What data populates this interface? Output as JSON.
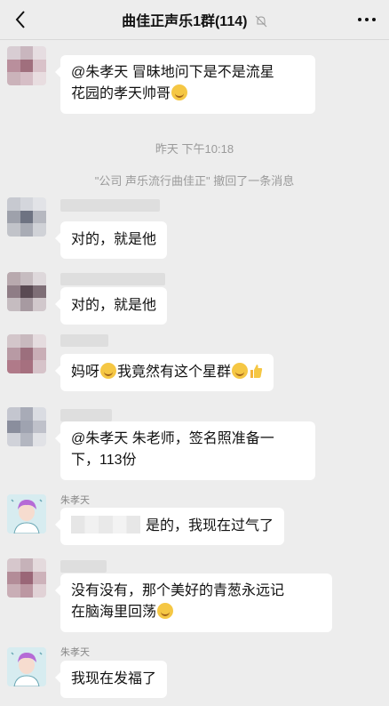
{
  "header": {
    "back_icon": "chevron-left-icon",
    "title": "曲佳正声乐1群(114)",
    "mute_icon": "bell-off-icon",
    "more_icon": "more-dots-icon"
  },
  "system": {
    "time": "昨天 下午10:18",
    "recall": "\"公司 声乐流行曲佳正\" 撤回了一条消息"
  },
  "messages": [
    {
      "text1": "@朱孝天 冒昧地问下是不是流星",
      "text2": "花园的孝天帅哥"
    },
    {
      "text": "对的，就是他"
    },
    {
      "text": "对的，就是他"
    },
    {
      "text_a": "妈呀",
      "text_b": "我竟然有这个星群"
    },
    {
      "text1": "@朱孝天 朱老师，签名照准备一",
      "text2": "下，113份"
    },
    {
      "sender": "朱孝天",
      "text": "是的，我现在过气了"
    },
    {
      "text1": "没有没有，那个美好的青葱永远记",
      "text2": "在脑海里回荡"
    },
    {
      "sender": "朱孝天",
      "text": "我现在发福了"
    }
  ],
  "colors": {
    "background": "#ededed",
    "bubble": "#ffffff",
    "system_text": "#9a9a9a"
  }
}
